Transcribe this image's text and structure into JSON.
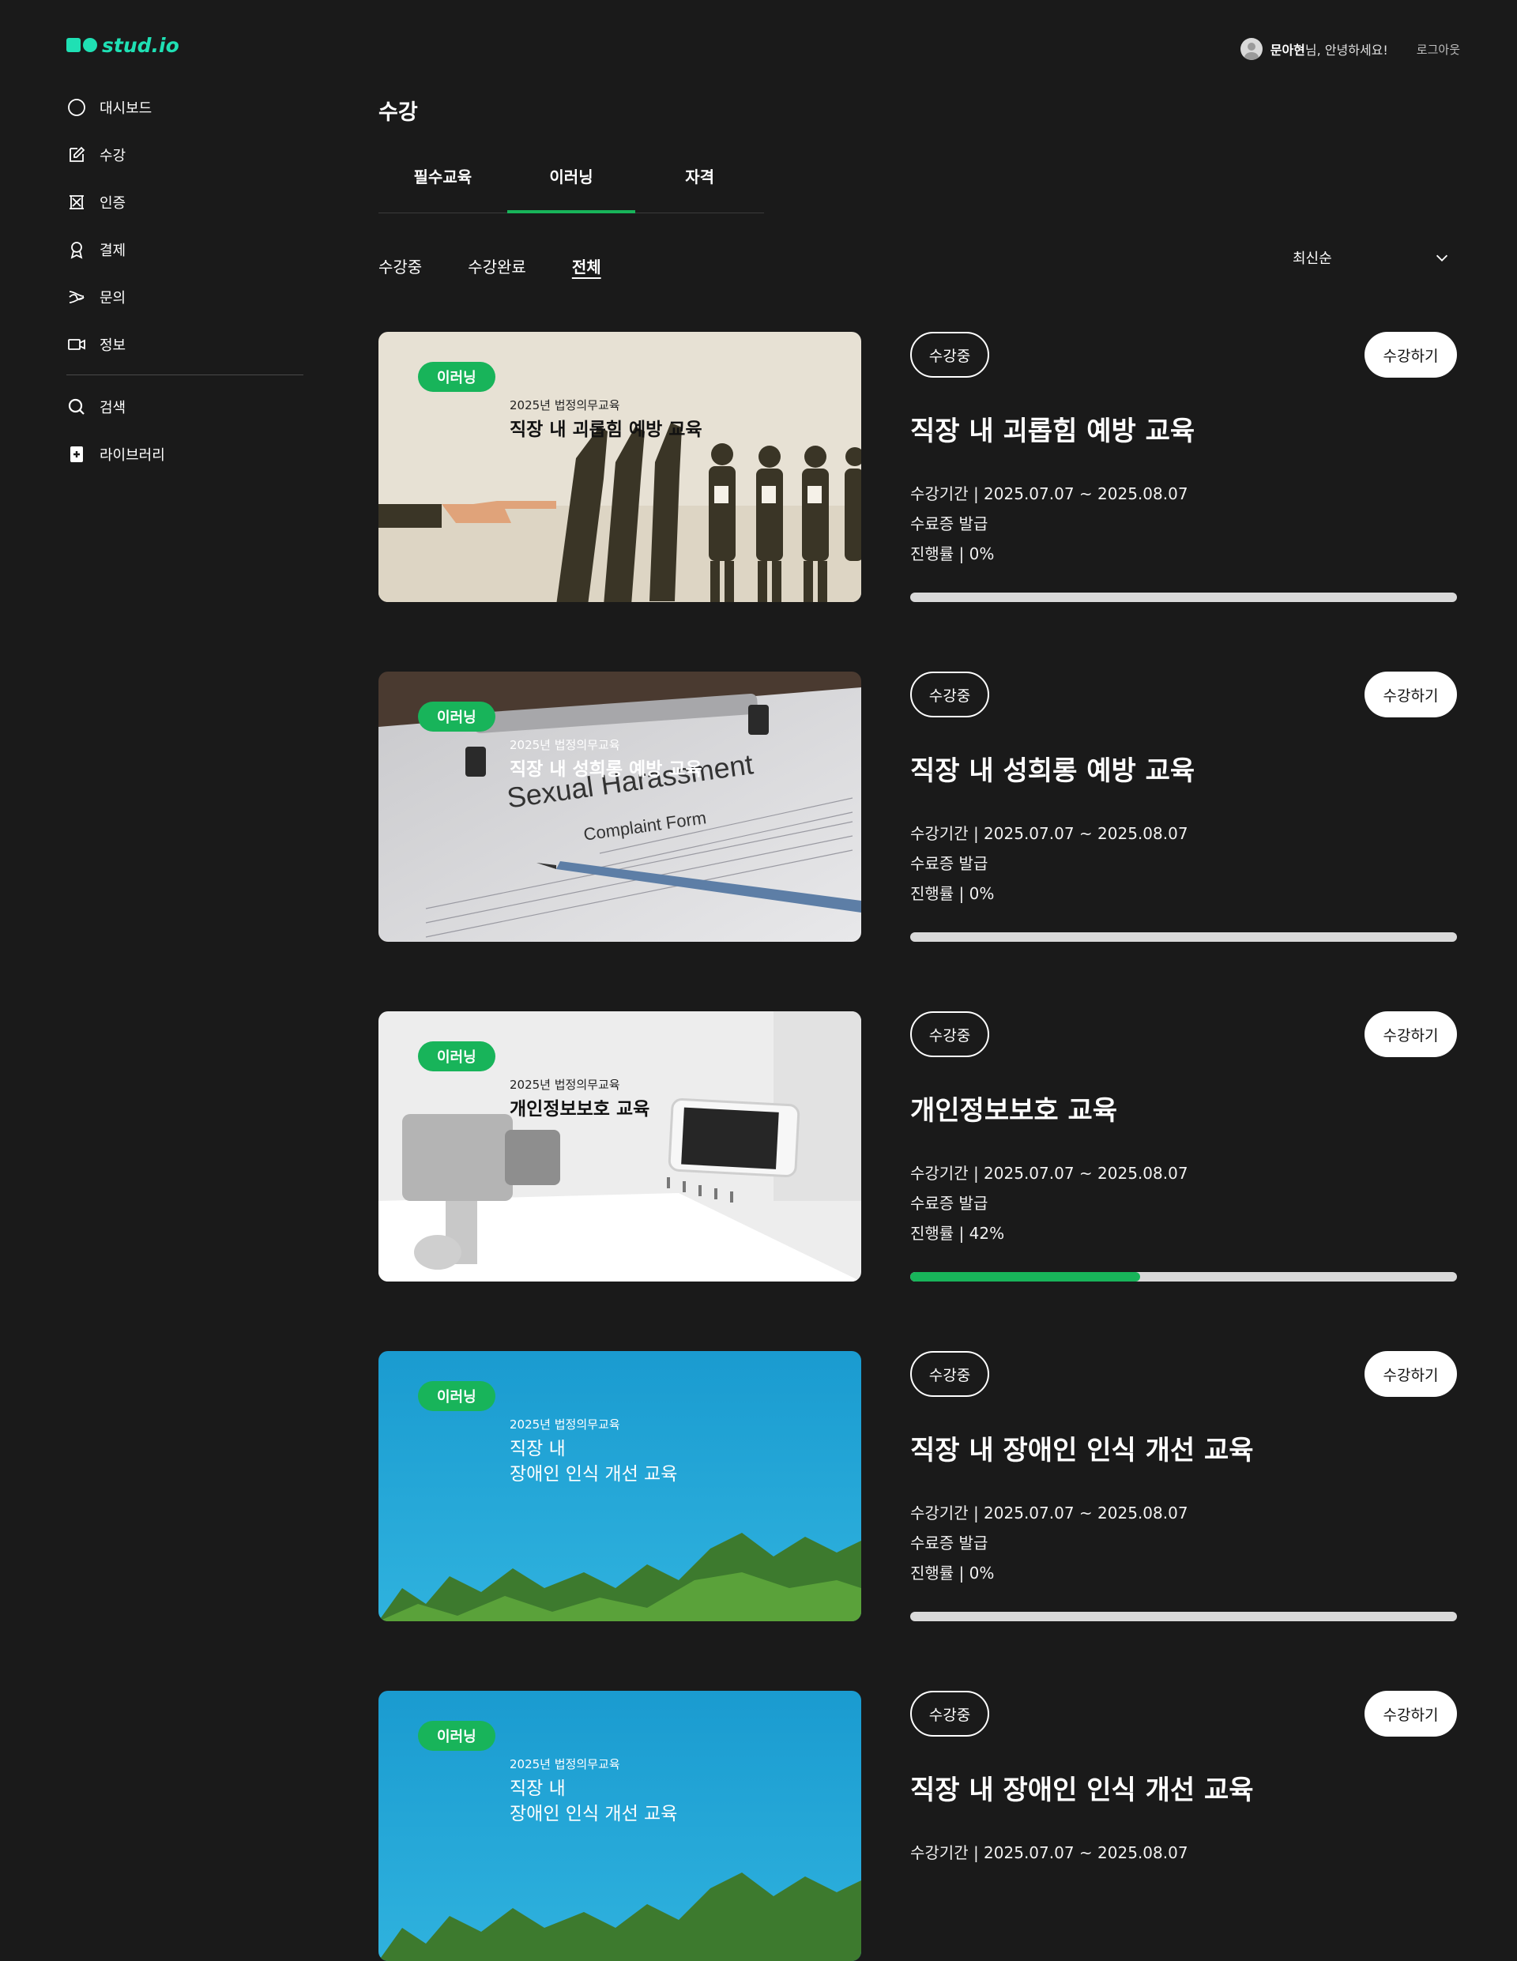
{
  "app": {
    "logo_text": "stud.io"
  },
  "user": {
    "name": "문아현",
    "greeting": "님, 안녕하세요!",
    "logout_label": "로그아웃"
  },
  "sidebar": {
    "items": [
      {
        "label": "대시보드",
        "icon": "circle-icon"
      },
      {
        "label": "수강",
        "icon": "edit-icon"
      },
      {
        "label": "인증",
        "icon": "certificate-icon"
      },
      {
        "label": "결제",
        "icon": "award-icon"
      },
      {
        "label": "문의",
        "icon": "inquiry-icon"
      },
      {
        "label": "정보",
        "icon": "video-icon"
      }
    ],
    "secondary": [
      {
        "label": "검색",
        "icon": "search-icon"
      },
      {
        "label": "라이브러리",
        "icon": "library-icon"
      }
    ]
  },
  "page": {
    "title": "수강",
    "tabs": [
      {
        "label": "필수교육",
        "active": false
      },
      {
        "label": "이러닝",
        "active": true
      },
      {
        "label": "자격",
        "active": false
      }
    ],
    "filters": [
      {
        "label": "수강중",
        "active": false
      },
      {
        "label": "수강완료",
        "active": false
      },
      {
        "label": "전체",
        "active": true
      }
    ],
    "sort": {
      "selected": "최신순"
    }
  },
  "colors": {
    "accent_green": "#18b45a",
    "logo_mint": "#1fe0b4",
    "background": "#1a1a1a"
  },
  "courses": [
    {
      "thumb_badge": "이러닝",
      "thumb_subtitle": "2025년 법정의무교육",
      "thumb_title": "직장 내 괴롭힘 예방 교육",
      "status": "수강중",
      "action": "수강하기",
      "title": "직장 내 괴롭힘 예방 교육",
      "period": "수강기간 | 2025.07.07 ~ 2025.08.07",
      "certificate": "수료증 발급",
      "progress_text": "진행률 | 0%",
      "progress": 0
    },
    {
      "thumb_badge": "이러닝",
      "thumb_subtitle": "2025년 법정의무교육",
      "thumb_title": "직장 내 성희롱 예방 교육",
      "thumb_paper_title": "Sexual Harassment",
      "thumb_paper_sub": "Complaint Form",
      "status": "수강중",
      "action": "수강하기",
      "title": "직장 내 성희롱 예방 교육",
      "period": "수강기간 | 2025.07.07 ~ 2025.08.07",
      "certificate": "수료증 발급",
      "progress_text": "진행률 | 0%",
      "progress": 0
    },
    {
      "thumb_badge": "이러닝",
      "thumb_subtitle": "2025년 법정의무교육",
      "thumb_title": "개인정보보호 교육",
      "status": "수강중",
      "action": "수강하기",
      "title": "개인정보보호 교육",
      "period": "수강기간 | 2025.07.07 ~ 2025.08.07",
      "certificate": "수료증 발급",
      "progress_text": "진행률 | 42%",
      "progress": 0.42
    },
    {
      "thumb_badge": "이러닝",
      "thumb_subtitle": "2025년 법정의무교육",
      "thumb_title": "직장 내\n장애인 인식 개선 교육",
      "status": "수강중",
      "action": "수강하기",
      "title": "직장 내 장애인 인식 개선 교육",
      "period": "수강기간 | 2025.07.07 ~ 2025.08.07",
      "certificate": "수료증 발급",
      "progress_text": "진행률 | 0%",
      "progress": 0
    },
    {
      "thumb_badge": "이러닝",
      "thumb_subtitle": "2025년 법정의무교육",
      "thumb_title": "직장 내\n장애인 인식 개선 교육",
      "status": "수강중",
      "action": "수강하기",
      "title": "직장 내 장애인 인식 개선 교육",
      "period": "수강기간 | 2025.07.07 ~ 2025.08.07",
      "certificate": "",
      "progress_text": "",
      "progress": 0
    }
  ]
}
